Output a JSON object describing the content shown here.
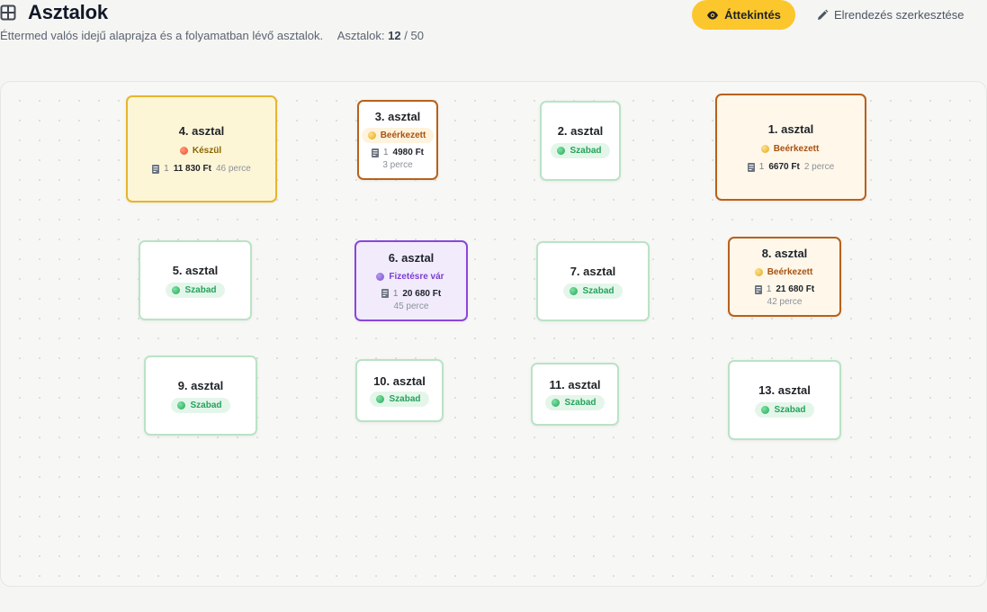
{
  "header": {
    "title": "Asztalok",
    "subtitle": "Éttermed valós idejű alaprajza és a folyamatban lévő asztalok.",
    "count_label": "Asztalok:",
    "count_active": "12",
    "count_sep": "/",
    "count_total": "50",
    "overview_button": "Áttekintés",
    "edit_button": "Elrendezés szerkesztése"
  },
  "colors": {
    "accent": "#fcc72c",
    "free": "#23a35a",
    "cooking": "#e6b52d",
    "arrived": "#b8611a",
    "payment": "#8b46dc"
  },
  "tables": [
    {
      "name": "4. asztal",
      "status": "Készül",
      "guests": "1",
      "amount": "11 830 Ft",
      "time": "46 perce"
    },
    {
      "name": "3. asztal",
      "status": "Beérkezett",
      "guests": "1",
      "amount": "4980 Ft",
      "time": "3 perce"
    },
    {
      "name": "2. asztal",
      "status": "Szabad"
    },
    {
      "name": "1. asztal",
      "status": "Beérkezett",
      "guests": "1",
      "amount": "6670 Ft",
      "time": "2 perce"
    },
    {
      "name": "5. asztal",
      "status": "Szabad"
    },
    {
      "name": "6. asztal",
      "status": "Fizetésre vár",
      "guests": "1",
      "amount": "20 680 Ft",
      "time": "45 perce"
    },
    {
      "name": "7. asztal",
      "status": "Szabad"
    },
    {
      "name": "8. asztal",
      "status": "Beérkezett",
      "guests": "1",
      "amount": "21 680 Ft",
      "time": "42 perce"
    },
    {
      "name": "9. asztal",
      "status": "Szabad"
    },
    {
      "name": "10. asztal",
      "status": "Szabad"
    },
    {
      "name": "11. asztal",
      "status": "Szabad"
    },
    {
      "name": "13. asztal",
      "status": "Szabad"
    }
  ]
}
